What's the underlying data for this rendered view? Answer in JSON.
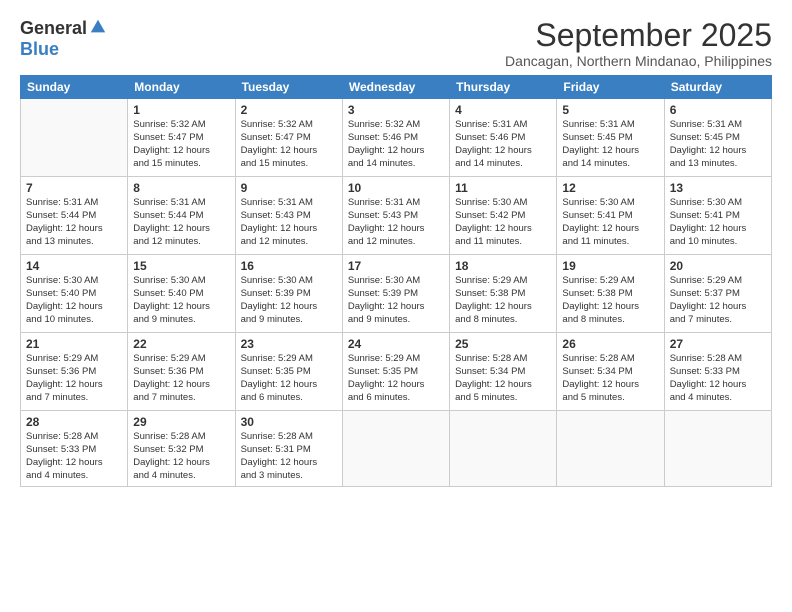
{
  "header": {
    "logo_general": "General",
    "logo_blue": "Blue",
    "month_title": "September 2025",
    "location": "Dancagan, Northern Mindanao, Philippines"
  },
  "weekdays": [
    "Sunday",
    "Monday",
    "Tuesday",
    "Wednesday",
    "Thursday",
    "Friday",
    "Saturday"
  ],
  "weeks": [
    [
      {
        "day": "",
        "info": ""
      },
      {
        "day": "1",
        "info": "Sunrise: 5:32 AM\nSunset: 5:47 PM\nDaylight: 12 hours\nand 15 minutes."
      },
      {
        "day": "2",
        "info": "Sunrise: 5:32 AM\nSunset: 5:47 PM\nDaylight: 12 hours\nand 15 minutes."
      },
      {
        "day": "3",
        "info": "Sunrise: 5:32 AM\nSunset: 5:46 PM\nDaylight: 12 hours\nand 14 minutes."
      },
      {
        "day": "4",
        "info": "Sunrise: 5:31 AM\nSunset: 5:46 PM\nDaylight: 12 hours\nand 14 minutes."
      },
      {
        "day": "5",
        "info": "Sunrise: 5:31 AM\nSunset: 5:45 PM\nDaylight: 12 hours\nand 14 minutes."
      },
      {
        "day": "6",
        "info": "Sunrise: 5:31 AM\nSunset: 5:45 PM\nDaylight: 12 hours\nand 13 minutes."
      }
    ],
    [
      {
        "day": "7",
        "info": "Sunrise: 5:31 AM\nSunset: 5:44 PM\nDaylight: 12 hours\nand 13 minutes."
      },
      {
        "day": "8",
        "info": "Sunrise: 5:31 AM\nSunset: 5:44 PM\nDaylight: 12 hours\nand 12 minutes."
      },
      {
        "day": "9",
        "info": "Sunrise: 5:31 AM\nSunset: 5:43 PM\nDaylight: 12 hours\nand 12 minutes."
      },
      {
        "day": "10",
        "info": "Sunrise: 5:31 AM\nSunset: 5:43 PM\nDaylight: 12 hours\nand 12 minutes."
      },
      {
        "day": "11",
        "info": "Sunrise: 5:30 AM\nSunset: 5:42 PM\nDaylight: 12 hours\nand 11 minutes."
      },
      {
        "day": "12",
        "info": "Sunrise: 5:30 AM\nSunset: 5:41 PM\nDaylight: 12 hours\nand 11 minutes."
      },
      {
        "day": "13",
        "info": "Sunrise: 5:30 AM\nSunset: 5:41 PM\nDaylight: 12 hours\nand 10 minutes."
      }
    ],
    [
      {
        "day": "14",
        "info": "Sunrise: 5:30 AM\nSunset: 5:40 PM\nDaylight: 12 hours\nand 10 minutes."
      },
      {
        "day": "15",
        "info": "Sunrise: 5:30 AM\nSunset: 5:40 PM\nDaylight: 12 hours\nand 9 minutes."
      },
      {
        "day": "16",
        "info": "Sunrise: 5:30 AM\nSunset: 5:39 PM\nDaylight: 12 hours\nand 9 minutes."
      },
      {
        "day": "17",
        "info": "Sunrise: 5:30 AM\nSunset: 5:39 PM\nDaylight: 12 hours\nand 9 minutes."
      },
      {
        "day": "18",
        "info": "Sunrise: 5:29 AM\nSunset: 5:38 PM\nDaylight: 12 hours\nand 8 minutes."
      },
      {
        "day": "19",
        "info": "Sunrise: 5:29 AM\nSunset: 5:38 PM\nDaylight: 12 hours\nand 8 minutes."
      },
      {
        "day": "20",
        "info": "Sunrise: 5:29 AM\nSunset: 5:37 PM\nDaylight: 12 hours\nand 7 minutes."
      }
    ],
    [
      {
        "day": "21",
        "info": "Sunrise: 5:29 AM\nSunset: 5:36 PM\nDaylight: 12 hours\nand 7 minutes."
      },
      {
        "day": "22",
        "info": "Sunrise: 5:29 AM\nSunset: 5:36 PM\nDaylight: 12 hours\nand 7 minutes."
      },
      {
        "day": "23",
        "info": "Sunrise: 5:29 AM\nSunset: 5:35 PM\nDaylight: 12 hours\nand 6 minutes."
      },
      {
        "day": "24",
        "info": "Sunrise: 5:29 AM\nSunset: 5:35 PM\nDaylight: 12 hours\nand 6 minutes."
      },
      {
        "day": "25",
        "info": "Sunrise: 5:28 AM\nSunset: 5:34 PM\nDaylight: 12 hours\nand 5 minutes."
      },
      {
        "day": "26",
        "info": "Sunrise: 5:28 AM\nSunset: 5:34 PM\nDaylight: 12 hours\nand 5 minutes."
      },
      {
        "day": "27",
        "info": "Sunrise: 5:28 AM\nSunset: 5:33 PM\nDaylight: 12 hours\nand 4 minutes."
      }
    ],
    [
      {
        "day": "28",
        "info": "Sunrise: 5:28 AM\nSunset: 5:33 PM\nDaylight: 12 hours\nand 4 minutes."
      },
      {
        "day": "29",
        "info": "Sunrise: 5:28 AM\nSunset: 5:32 PM\nDaylight: 12 hours\nand 4 minutes."
      },
      {
        "day": "30",
        "info": "Sunrise: 5:28 AM\nSunset: 5:31 PM\nDaylight: 12 hours\nand 3 minutes."
      },
      {
        "day": "",
        "info": ""
      },
      {
        "day": "",
        "info": ""
      },
      {
        "day": "",
        "info": ""
      },
      {
        "day": "",
        "info": ""
      }
    ]
  ]
}
